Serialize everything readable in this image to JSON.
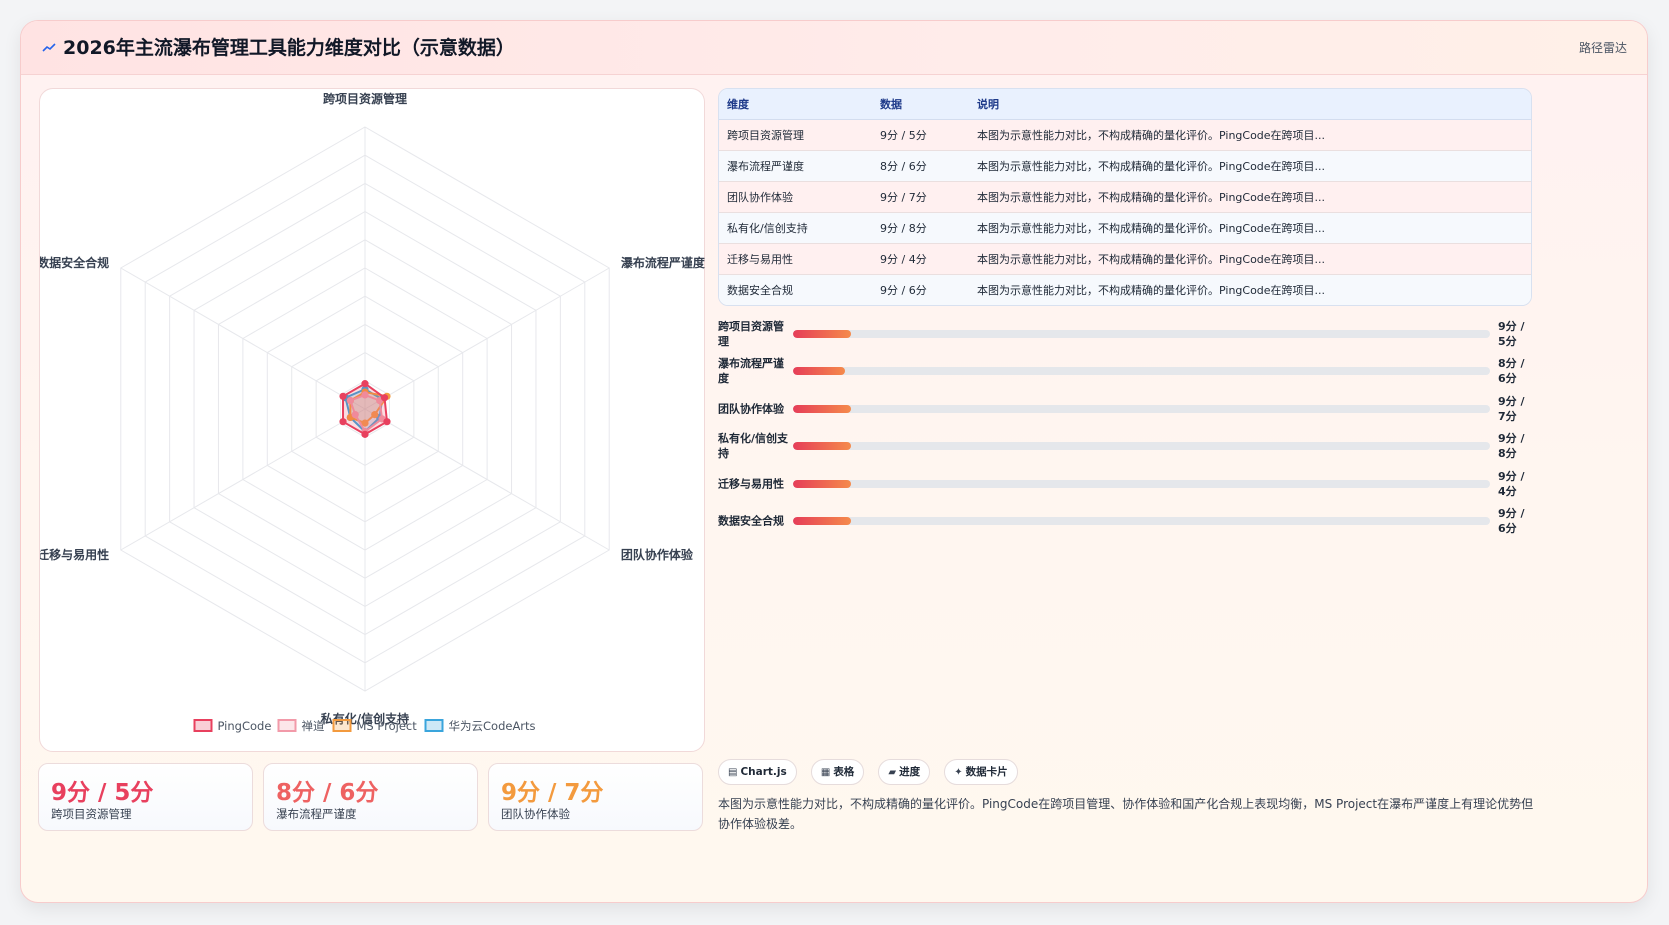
{
  "header": {
    "title": "2026年主流瀑布管理工具能力维度对比（示意数据）",
    "tag": "路径雷达",
    "icon": "trend-line-icon"
  },
  "colors": {
    "PingCode": "#e8405e",
    "禅道": "#f29aa9",
    "MS Project": "#f39a3e",
    "华为云CodeArts": "#3aa5dc",
    "accent_red": "#e8405e",
    "accent_orange": "#f39a3e"
  },
  "chart_data": {
    "type": "radar",
    "axes": [
      "跨项目资源管理",
      "瀑布流程严谨度",
      "团队协作体验",
      "私有化/信创支持",
      "迁移与易用性",
      "数据安全合规"
    ],
    "series": [
      {
        "name": "PingCode",
        "values": [
          9,
          8,
          9,
          9,
          9,
          9
        ]
      },
      {
        "name": "禅道",
        "values": [
          5,
          6,
          7,
          8,
          4,
          6
        ]
      },
      {
        "name": "MS Project",
        "values": [
          6,
          9,
          4,
          5,
          6,
          6
        ]
      },
      {
        "name": "华为云CodeArts",
        "values": [
          7,
          7,
          6,
          8,
          6,
          8
        ]
      }
    ],
    "rmax": 100,
    "rings": 10,
    "legend_position": "bottom",
    "grid": true
  },
  "table": {
    "headers": [
      "维度",
      "数据",
      "说明"
    ],
    "rows": [
      {
        "dimension": "跨项目资源管理",
        "data": "9分 / 5分",
        "note": "本图为示意性能力对比，不构成精确的量化评价。PingCode在跨项目..."
      },
      {
        "dimension": "瀑布流程严谨度",
        "data": "8分 / 6分",
        "note": "本图为示意性能力对比，不构成精确的量化评价。PingCode在跨项目..."
      },
      {
        "dimension": "团队协作体验",
        "data": "9分 / 7分",
        "note": "本图为示意性能力对比，不构成精确的量化评价。PingCode在跨项目..."
      },
      {
        "dimension": "私有化/信创支持",
        "data": "9分 / 8分",
        "note": "本图为示意性能力对比，不构成精确的量化评价。PingCode在跨项目..."
      },
      {
        "dimension": "迁移与易用性",
        "data": "9分 / 4分",
        "note": "本图为示意性能力对比，不构成精确的量化评价。PingCode在跨项目..."
      },
      {
        "dimension": "数据安全合规",
        "data": "9分 / 6分",
        "note": "本图为示意性能力对比，不构成精确的量化评价。PingCode在跨项目..."
      }
    ]
  },
  "progress": [
    {
      "label": "跨项目资源管理",
      "value_label": "9分 / 5分",
      "fraction": 0.083
    },
    {
      "label": "瀑布流程严谨度",
      "value_label": "8分 / 6分",
      "fraction": 0.074
    },
    {
      "label": "团队协作体验",
      "value_label": "9分 / 7分",
      "fraction": 0.083
    },
    {
      "label": "私有化/信创支持",
      "value_label": "9分 / 8分",
      "fraction": 0.083
    },
    {
      "label": "迁移与易用性",
      "value_label": "9分 / 4分",
      "fraction": 0.083
    },
    {
      "label": "数据安全合规",
      "value_label": "9分 / 6分",
      "fraction": 0.083
    }
  ],
  "stat_cards": [
    {
      "value": "9分 / 5分",
      "label": "跨项目资源管理",
      "color": "#e8405e"
    },
    {
      "value": "8分 / 6分",
      "label": "瀑布流程严谨度",
      "color": "#ee6262"
    },
    {
      "value": "9分 / 7分",
      "label": "团队协作体验",
      "color": "#f39a3e"
    }
  ],
  "pills": [
    {
      "icon": "▤",
      "icon_name": "chart-icon",
      "label": "Chart.js"
    },
    {
      "icon": "▦",
      "icon_name": "table-icon",
      "label": "表格"
    },
    {
      "icon": "▰",
      "icon_name": "progress-icon",
      "label": "进度"
    },
    {
      "icon": "✦",
      "icon_name": "sparkle-icon",
      "label": "数据卡片"
    }
  ],
  "footnote": "本图为示意性能力对比，不构成精确的量化评价。PingCode在跨项目管理、协作体验和国产化合规上表现均衡，MS Project在瀑布严谨度上有理论优势但协作体验极差。"
}
